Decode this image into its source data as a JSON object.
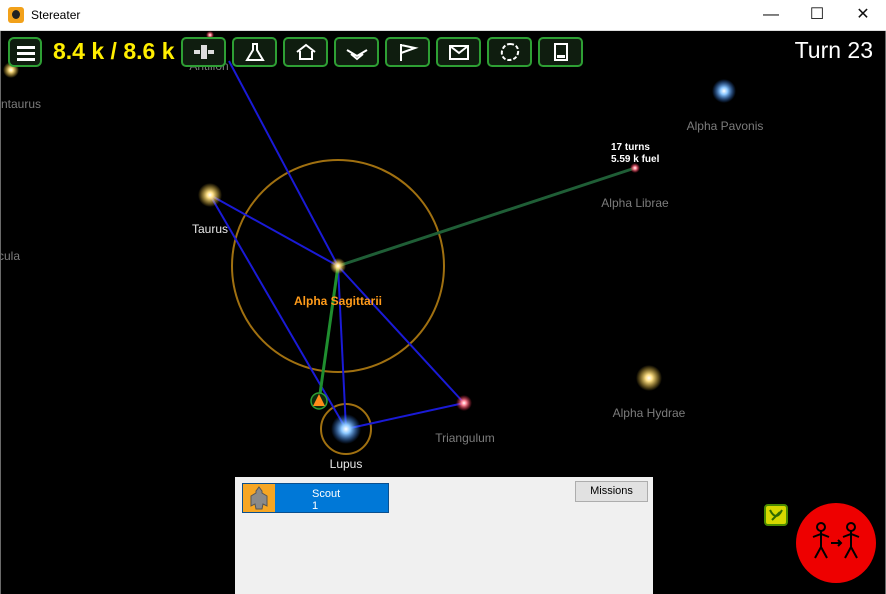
{
  "window": {
    "title": "Stereater",
    "minimize_glyph": "—",
    "maximize_glyph": "☐",
    "close_glyph": "✕"
  },
  "hud": {
    "energy": "8.4 k / 8.6 k",
    "turn": "Turn 23",
    "toolbar_buttons": [
      {
        "name": "colonize-icon"
      },
      {
        "name": "research-flask-icon"
      },
      {
        "name": "development-icon"
      },
      {
        "name": "ship-design-icon"
      },
      {
        "name": "flag-icon"
      },
      {
        "name": "mail-icon"
      },
      {
        "name": "library-icon"
      },
      {
        "name": "reports-icon"
      }
    ]
  },
  "map": {
    "stars": [
      {
        "name": "Taurus"
      },
      {
        "name": "Alpha Sagittarii"
      },
      {
        "name": "Lupus"
      },
      {
        "name": "Triangulum"
      },
      {
        "name": "Alpha Librae"
      },
      {
        "name": "Alpha Pavonis"
      },
      {
        "name": "Alpha Hydrae"
      },
      {
        "name": "ntaurus"
      },
      {
        "name": "cula"
      },
      {
        "name": "Antilion"
      }
    ],
    "eta_turns": "17 turns",
    "eta_fuel": "5.59 k fuel",
    "colors": {
      "starlane": "#1a1ad6",
      "route": "#1f5e36",
      "selection_ring": "#a07010",
      "highlight_label": "#ff9b1a"
    }
  },
  "fleet_panel": {
    "fleet_name": "Scout",
    "fleet_count": "1",
    "missions_label": "Missions"
  },
  "end_turn": {
    "icon": "end-turn-icon",
    "color": "#ee0000"
  }
}
